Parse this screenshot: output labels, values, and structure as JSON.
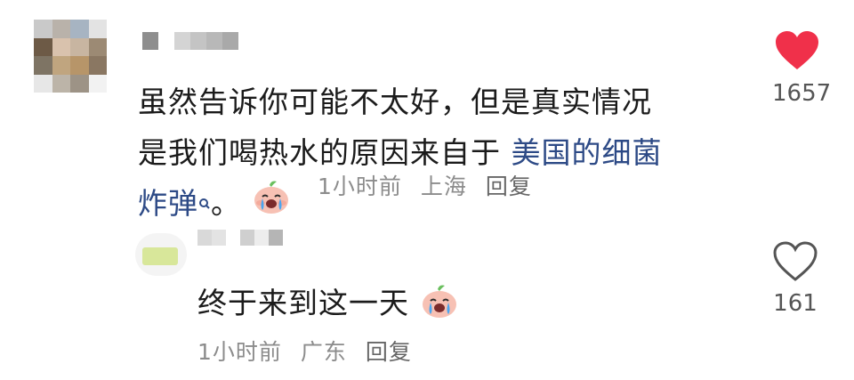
{
  "colors": {
    "link": "#2d4a86",
    "meta": "#8c8c8c",
    "heart_active": "#f0304a",
    "text": "#1b1b1b"
  },
  "comment": {
    "text_line1": "虽然告诉你可能不太好，但是真实情况",
    "text_line2_plain": "是我们喝热水的原因来自于",
    "link_text_part1": "美国的细菌",
    "link_text_part2": "炸弹",
    "text_end": "。",
    "link_icon": "search-icon",
    "emoji": "crying-peach-emoji",
    "time": "1小时前",
    "location": "上海",
    "reply_label": "回复",
    "like_icon": "heart-filled-icon",
    "like_count": "1657"
  },
  "reply_comment": {
    "text": "终于来到这一天",
    "emoji": "crying-peach-emoji",
    "time": "1小时前",
    "location": "广东",
    "reply_label": "回复",
    "like_icon": "heart-outline-icon",
    "like_count": "161"
  }
}
